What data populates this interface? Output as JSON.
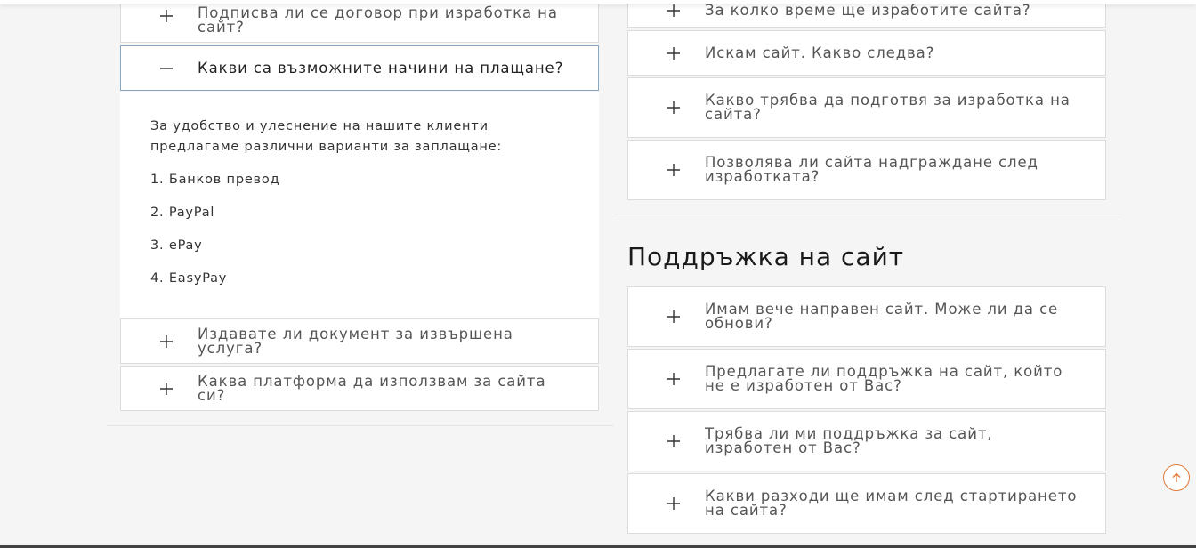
{
  "left_faq": {
    "items": [
      {
        "question": "Подписва ли се договор при изработка на сайт?",
        "state": "collapsed"
      },
      {
        "question": "Какви са възможните начини на плащане?",
        "state": "expanded"
      },
      {
        "question": "Издавате ли документ за извършена услуга?",
        "state": "collapsed"
      },
      {
        "question": "Каква платформа да използвам за сайта си?",
        "state": "collapsed"
      }
    ],
    "answer": {
      "intro": "За удобство и улеснение на нашите клиенти предлагаме различни варианти за заплащане:",
      "options": [
        "1. Банков превод",
        "2. PayPal",
        "3. ePay",
        "4. EasyPay"
      ]
    }
  },
  "right_faq": {
    "items": [
      {
        "question": "За колко време ще изработите сайта?"
      },
      {
        "question": "Искам сайт. Какво следва?"
      },
      {
        "question": "Какво трябва да подготвя за изработка на сайта?"
      },
      {
        "question": "Позволява ли сайта надграждане след изработката?"
      }
    ]
  },
  "support": {
    "title": "Поддръжка на сайт",
    "items": [
      {
        "question": "Имам вече направен сайт. Може ли да се обнови?"
      },
      {
        "question": "Предлагате ли поддръжка на сайт, който не е изработен от Вас?"
      },
      {
        "question": "Трябва ли ми поддръжка за сайт, изработен от Вас?"
      },
      {
        "question": "Какви разходи ще имам след стартирането на сайта?"
      }
    ]
  },
  "icons": {
    "collapsed": "plus-icon",
    "expanded": "minus-icon",
    "scroll_top": "arrow-up-icon"
  },
  "colors": {
    "accent": "#e07b39",
    "active_border": "#8aa7c2",
    "background": "#f5f5f5"
  }
}
